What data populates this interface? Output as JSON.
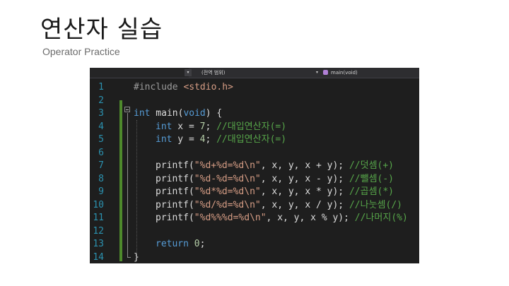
{
  "slide": {
    "title": "연산자 실습",
    "subtitle": "Operator Practice"
  },
  "editor": {
    "nav": {
      "scope_label": "(전역 범위)",
      "function_label": "main(void)",
      "function_icon": "method-icon",
      "caret": "▾"
    },
    "colors": {
      "background": "#1e1e1e",
      "line_number": "#2b91af",
      "keyword": "#569cd6",
      "string": "#d69d85",
      "comment": "#57a64a",
      "change_bar": "#4e8a2c"
    },
    "line_numbers": [
      "1",
      "2",
      "3",
      "4",
      "5",
      "6",
      "7",
      "8",
      "9",
      "10",
      "11",
      "12",
      "13",
      "14"
    ],
    "code": {
      "l1": {
        "directive": "#include",
        "header": "<stdio.h>"
      },
      "l3": {
        "type": "int",
        "name": " main(",
        "param": "void",
        "rest": ") {"
      },
      "l4": {
        "type": "int",
        "decl": " x = ",
        "value": "7",
        "semi": "; ",
        "comment": "//대입연산자(=)"
      },
      "l5": {
        "type": "int",
        "decl": " y = ",
        "value": "4",
        "semi": "; ",
        "comment": "//대입연산자(=)"
      },
      "l7": {
        "func": "printf(",
        "str": "\"%d+%d=%d\\n\"",
        "args": ", x, y, x + y); ",
        "comment": "//덧셈(+)"
      },
      "l8": {
        "func": "printf(",
        "str": "\"%d-%d=%d\\n\"",
        "args": ", x, y, x - y); ",
        "comment": "//뺄셈(-)"
      },
      "l9": {
        "func": "printf(",
        "str": "\"%d*%d=%d\\n\"",
        "args": ", x, y, x * y); ",
        "comment": "//곱셈(*)"
      },
      "l10": {
        "func": "printf(",
        "str": "\"%d/%d=%d\\n\"",
        "args": ", x, y, x / y); ",
        "comment": "//나눗셈(/)"
      },
      "l11": {
        "func": "printf(",
        "str": "\"%d%%%d=%d\\n\"",
        "args": ", x, y, x % y); ",
        "comment": "//나머지(%)"
      },
      "l13": {
        "keyword": "return",
        "value": " 0",
        "semi": ";"
      },
      "l14": {
        "brace": "}"
      }
    }
  }
}
